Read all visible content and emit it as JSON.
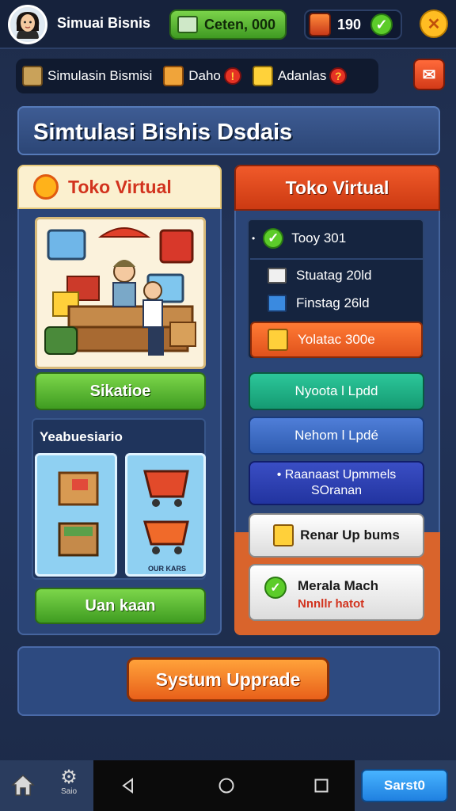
{
  "top": {
    "app_title": "Simuai Bisnis",
    "cash_label": "Ceten, 000",
    "gems_value": "190"
  },
  "subnav": {
    "items": [
      {
        "label": "Simulasin Bismisi",
        "badge": ""
      },
      {
        "label": "Daho",
        "badge": "!"
      },
      {
        "label": "Adanlas",
        "badge": "?"
      }
    ]
  },
  "banner": {
    "title": "Simtulasi Bishis Dsdais"
  },
  "left_panel": {
    "title": "Toko Virtual",
    "primary_button": "Sikatioe",
    "section_title": "Yeabuesiario",
    "tile_caption": "OUR KARS",
    "secondary_button": "Uan kaan"
  },
  "right_panel": {
    "title": "Toko Virtual",
    "list": [
      {
        "label": "Tooy 301",
        "prefix": "•"
      },
      {
        "label": "Stuatag 20ld"
      },
      {
        "label": "Finstag 26ld"
      },
      {
        "label": "Yolatac 300e"
      }
    ],
    "buttons": [
      "Nyoota l Lpdd",
      "Nehom l Lpdé",
      "• Raanaast Upmmels SOranan",
      "Renar Up bums"
    ],
    "status_card": {
      "title": "Merala Mach",
      "subtitle": "Nnnllr hatot"
    }
  },
  "upgrade": {
    "label": "Systum Upprade"
  },
  "navbar": {
    "settings_caption": "Saio",
    "start_label": "Sarst0"
  },
  "colors": {
    "accent_green": "#3f9c21",
    "accent_orange": "#e8601a",
    "panel_blue": "#2b4577",
    "danger_red": "#e53224"
  }
}
